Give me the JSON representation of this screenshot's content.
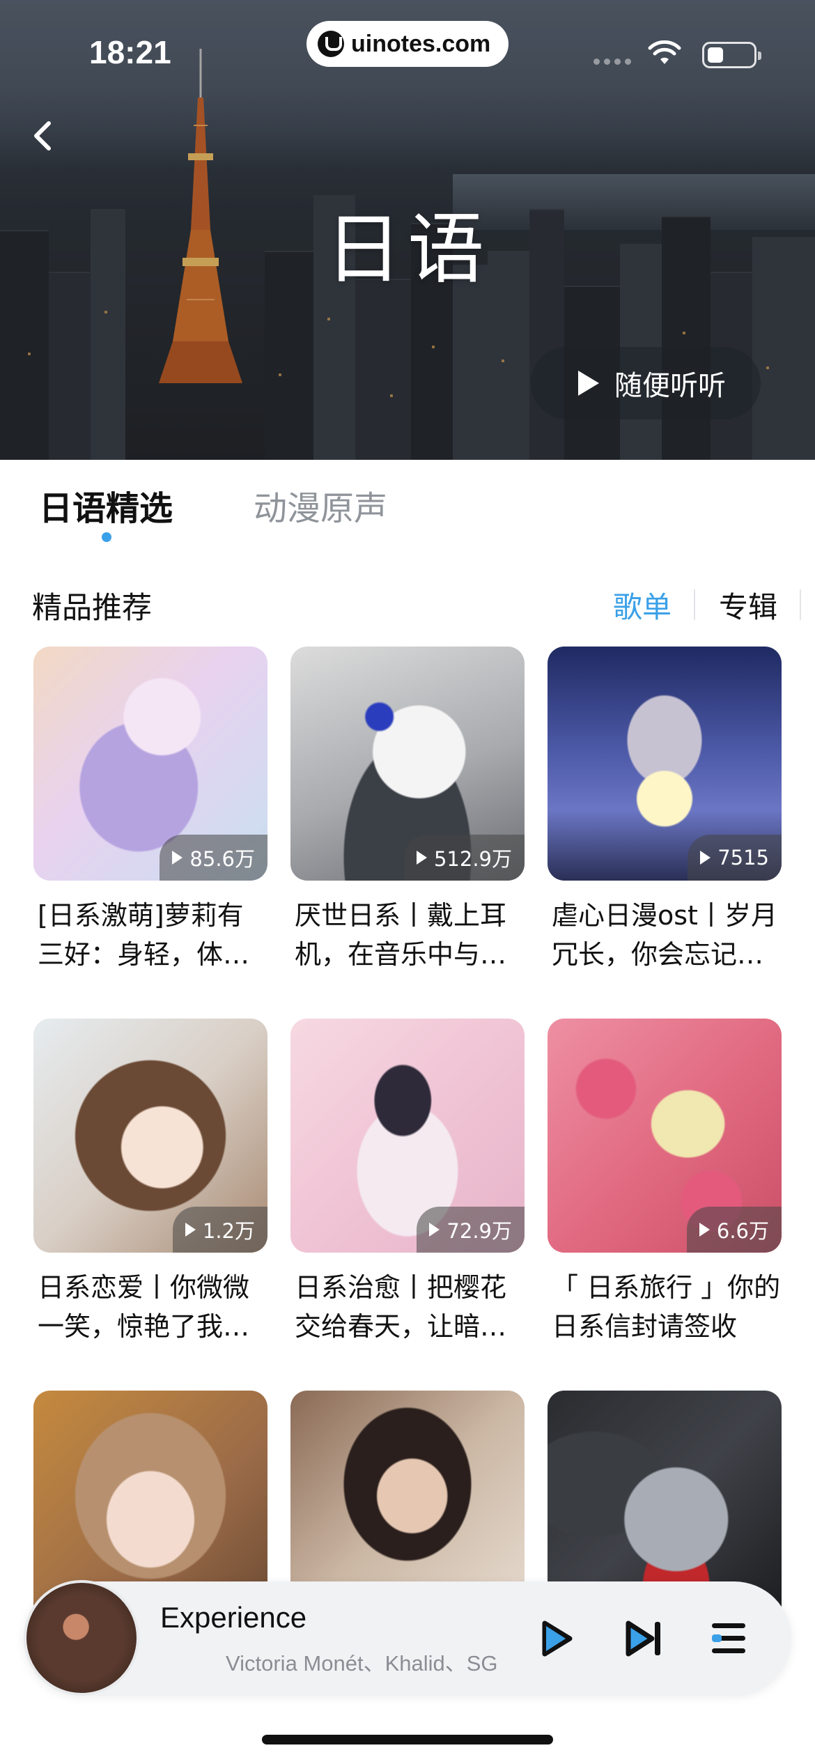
{
  "status_bar": {
    "time": "18:21",
    "url": "uinotes.com"
  },
  "hero": {
    "title": "日语",
    "shuffle_label": "随便听听"
  },
  "tabs": [
    {
      "label": "日语精选",
      "active": true
    },
    {
      "label": "动漫原声",
      "active": false
    }
  ],
  "section": {
    "title": "精品推荐",
    "segment_playlist": "歌单",
    "segment_album": "专辑"
  },
  "cards": [
    {
      "plays": "85.6万",
      "title": "[日系激萌]萝莉有三好：身轻，体柔，易推倒"
    },
    {
      "plays": "512.9万",
      "title": "厌世日系丨戴上耳机，在音乐中与世界和解"
    },
    {
      "plays": "7515",
      "title": "虐心日漫ost丨岁月冗长，你会忘记我吗"
    },
    {
      "plays": "1.2万",
      "title": "日系恋爱丨你微微一笑，惊艳了我的整个青春"
    },
    {
      "plays": "72.9万",
      "title": "日系治愈丨把樱花交给春天，让暗恋开出花"
    },
    {
      "plays": "6.6万",
      "title": "「 日系旅行 」你的日系信封请签收"
    },
    {
      "plays": "",
      "title": ""
    },
    {
      "plays": "",
      "title": ""
    },
    {
      "plays": "",
      "title": ""
    }
  ],
  "player": {
    "title": "Experience",
    "artist": "Victoria Monét、Khalid、SG Lewis"
  },
  "colors": {
    "accent": "#3aa0e8",
    "player_bg": "#f1f2f4"
  }
}
